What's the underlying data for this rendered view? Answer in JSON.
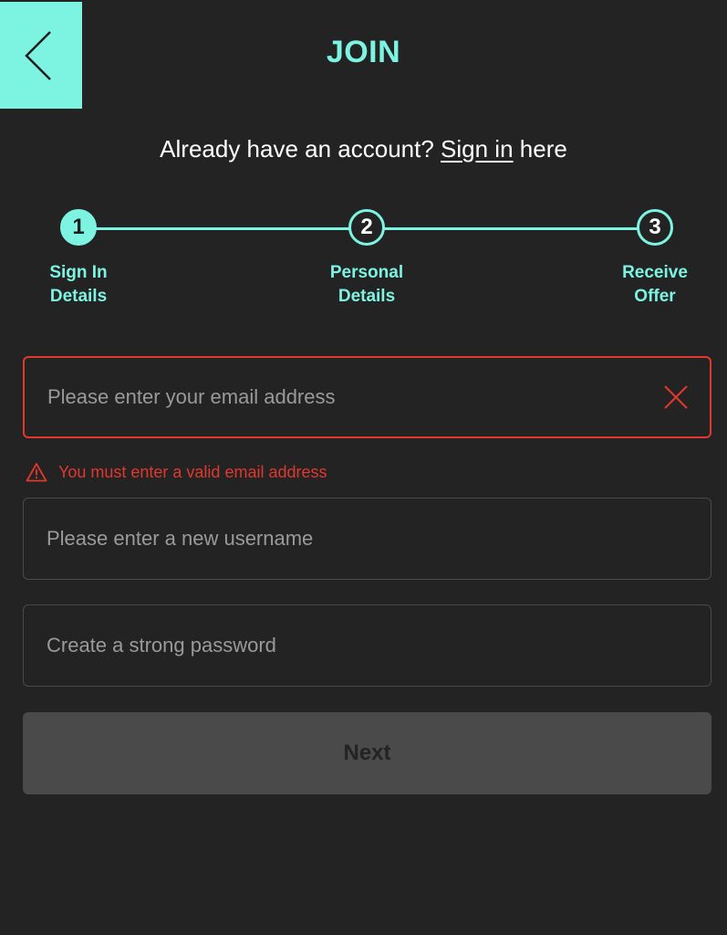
{
  "header": {
    "title": "JOIN",
    "back_icon": "chevron-left-icon"
  },
  "signin_prompt": {
    "prefix": "Already have an account? ",
    "link": "Sign in",
    "suffix": " here"
  },
  "stepper": {
    "steps": [
      {
        "number": "1",
        "label_line1": "Sign In",
        "label_line2": "Details",
        "state": "active"
      },
      {
        "number": "2",
        "label_line1": "Personal",
        "label_line2": "Details",
        "state": "inactive"
      },
      {
        "number": "3",
        "label_line1": "Receive",
        "label_line2": "Offer",
        "state": "inactive"
      }
    ]
  },
  "form": {
    "email": {
      "value": "",
      "placeholder": "Please enter your email address",
      "error": "You must enter a valid email address",
      "clear_icon": "close-icon",
      "warning_icon": "warning-icon"
    },
    "username": {
      "value": "",
      "placeholder": "Please enter a new username"
    },
    "password": {
      "value": "",
      "placeholder": "Create a strong password"
    },
    "next_label": "Next"
  },
  "colors": {
    "background": "#232323",
    "accent": "#7df3e1",
    "error": "#e0382d",
    "disabled": "#4a4a4a"
  }
}
